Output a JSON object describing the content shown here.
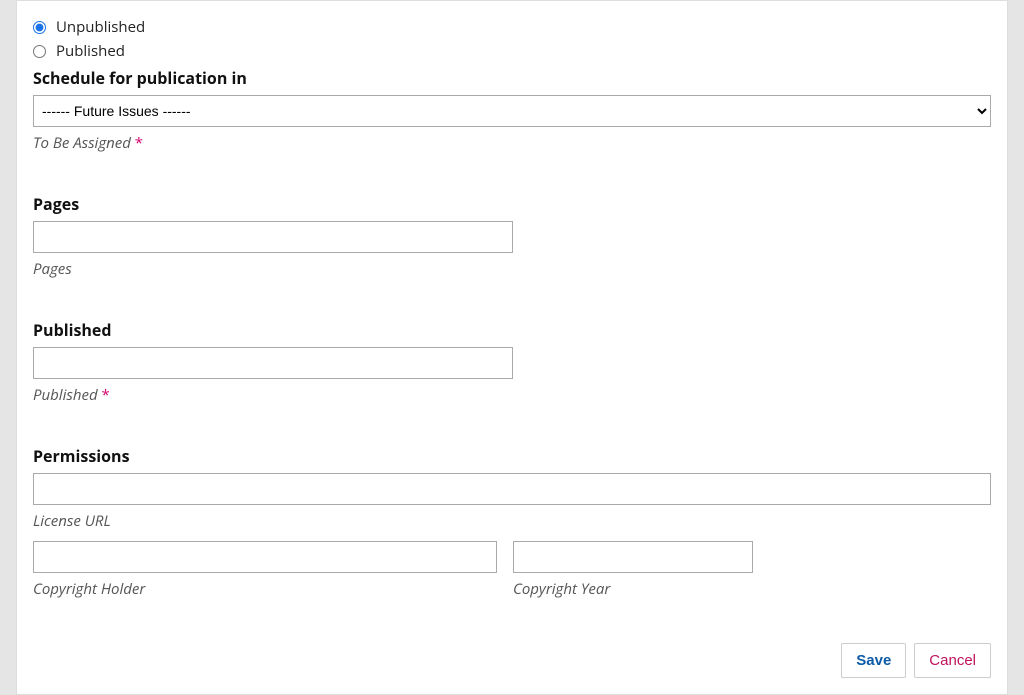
{
  "status": {
    "unpublished_label": "Unpublished",
    "published_label": "Published"
  },
  "schedule": {
    "heading": "Schedule for publication in",
    "selected": "------ Future Issues ------",
    "helper": "To Be Assigned"
  },
  "pages": {
    "heading": "Pages",
    "helper": "Pages",
    "value": ""
  },
  "published": {
    "heading": "Published",
    "helper": "Published",
    "value": ""
  },
  "permissions": {
    "heading": "Permissions",
    "license_url_helper": "License URL",
    "license_url_value": "",
    "copyright_holder_helper": "Copyright Holder",
    "copyright_holder_value": "",
    "copyright_year_helper": "Copyright Year",
    "copyright_year_value": ""
  },
  "actions": {
    "save": "Save",
    "cancel": "Cancel"
  },
  "required_mark": "*"
}
